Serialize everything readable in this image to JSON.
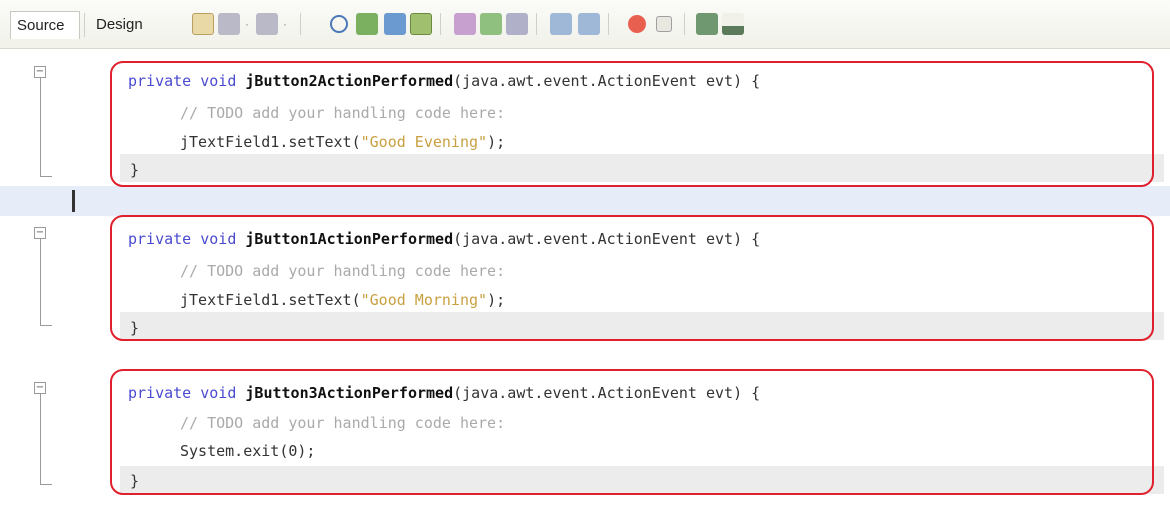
{
  "tabs": {
    "source": "Source",
    "design": "Design"
  },
  "toolbar": {
    "icons": [
      "last-edit-icon",
      "back-icon",
      "forward-icon",
      "find-icon",
      "find-previous-icon",
      "find-next-icon",
      "toggle-highlight-icon",
      "previous-bookmark-icon",
      "next-bookmark-icon",
      "toggle-bookmark-icon",
      "shift-left-icon",
      "shift-right-icon",
      "start-macro-icon",
      "stop-macro-icon",
      "comment-icon",
      "uncomment-icon"
    ]
  },
  "methods": [
    {
      "kw1": "private",
      "kw2": "void",
      "name": "jButton2ActionPerformed",
      "params": "(java.awt.event.ActionEvent evt) {",
      "comment": "// TODO add your handling code here:",
      "call_obj": "jTextField1.setText(",
      "call_str": "\"Good Evening\"",
      "call_end": ");",
      "close": "}"
    },
    {
      "kw1": "private",
      "kw2": "void",
      "name": "jButton1ActionPerformed",
      "params": "(java.awt.event.ActionEvent evt) {",
      "comment": "// TODO add your handling code here:",
      "call_obj": "jTextField1.setText(",
      "call_str": "\"Good Morning\"",
      "call_end": ");",
      "close": "}"
    },
    {
      "kw1": "private",
      "kw2": "void",
      "name": "jButton3ActionPerformed",
      "params": "(java.awt.event.ActionEvent evt) {",
      "comment": "// TODO add your handling code here:",
      "call_obj": "System.exit(0);",
      "call_str": "",
      "call_end": "",
      "close": "}"
    }
  ],
  "colors": {
    "keyword": "#4a4ad0",
    "comment": "#aaaaaa",
    "string": "#c8a040",
    "highlight_border": "#e0202c"
  }
}
